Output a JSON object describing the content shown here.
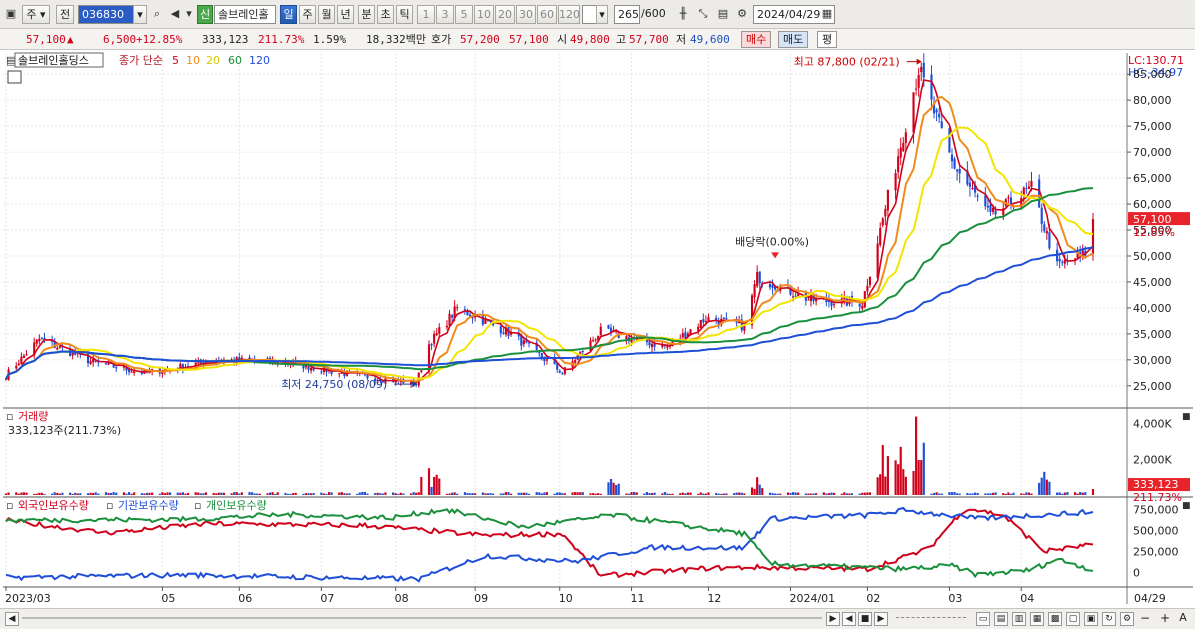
{
  "toolbar": {
    "period_main": "주",
    "prefix": "전",
    "stock_code": "036830",
    "new_badge": "신",
    "stock_name": "솔브레인홀",
    "periods": [
      "일",
      "주",
      "월",
      "년",
      "분",
      "초",
      "틱"
    ],
    "active_period": "일",
    "intervals": [
      "1",
      "3",
      "5",
      "10",
      "20",
      "30",
      "60",
      "120"
    ],
    "count_value": "265",
    "count_total": "/600",
    "date": "2024/04/29"
  },
  "quote": {
    "price": "57,100",
    "arrow": "▲",
    "change": "6,500",
    "change_pct": "+12.85%",
    "volume": "333,123",
    "volume_ratio": "211.73%",
    "turnover": "1.59%",
    "amount": "18,332백만",
    "ask_label": "호가",
    "ask1": "57,200",
    "ask2": "57,100",
    "open_label": "시",
    "open": "49,800",
    "high_label": "고",
    "high": "57,700",
    "low_label": "저",
    "low": "49,600",
    "buy": "매수",
    "sell": "매도",
    "flat": "평"
  },
  "chart_data": [
    {
      "type": "candlestick",
      "title": "솔브레인홀딩스",
      "indicator_label": "종가 단순",
      "ma_periods": [
        "5",
        "10",
        "20",
        "60",
        "120"
      ],
      "ma_colors": [
        "#d0021b",
        "#f08c1c",
        "#f2e600",
        "#1a8f3c",
        "#1f4fd8"
      ],
      "up_color": "#d0021b",
      "down_color": "#1f4fd8",
      "y_ticks": [
        85000,
        80000,
        75000,
        70000,
        65000,
        60000,
        55000,
        50000,
        45000,
        40000,
        35000,
        30000,
        25000
      ],
      "y_tick_labels": [
        "85,000",
        "80,000",
        "75,000",
        "70,000",
        "65,000",
        "60,000",
        "55,000",
        "50,000",
        "45,000",
        "40,000",
        "35,000",
        "30,000",
        "25,000"
      ],
      "ylim": [
        21500,
        88500
      ],
      "lc_label": "LC:130.71",
      "hc_label": "HC:-34.97",
      "last_price_label": "57,100",
      "last_pct_label": "12.85%",
      "annotations": [
        {
          "text": "최고 87,800 (02/21)",
          "date": "2024-02-21",
          "value": 87800
        },
        {
          "text": "최저 24,750 (08/09)",
          "date": "2023-08-09",
          "value": 24750
        },
        {
          "text": "배당락(0.00%)",
          "date": "2023-12-27",
          "value": 48000
        }
      ],
      "close_key_points": [
        [
          "2023-03-02",
          27000
        ],
        [
          "2023-03-15",
          34000
        ],
        [
          "2023-04-05",
          29500
        ],
        [
          "2023-04-25",
          27500
        ],
        [
          "2023-05-25",
          30000
        ],
        [
          "2023-06-20",
          29500
        ],
        [
          "2023-07-10",
          27500
        ],
        [
          "2023-08-09",
          25500
        ],
        [
          "2023-08-14",
          33000
        ],
        [
          "2023-08-25",
          40000
        ],
        [
          "2023-09-15",
          35000
        ],
        [
          "2023-10-05",
          27500
        ],
        [
          "2023-10-20",
          35500
        ],
        [
          "2023-11-15",
          32500
        ],
        [
          "2023-11-30",
          38000
        ],
        [
          "2023-12-15",
          36500
        ],
        [
          "2023-12-20",
          46000
        ],
        [
          "2024-01-10",
          41500
        ],
        [
          "2024-01-30",
          41000
        ],
        [
          "2024-02-06",
          55000
        ],
        [
          "2024-02-21",
          86000
        ],
        [
          "2024-03-05",
          68000
        ],
        [
          "2024-03-20",
          57500
        ],
        [
          "2024-04-05",
          63000
        ],
        [
          "2024-04-15",
          48000
        ],
        [
          "2024-04-26",
          50600
        ],
        [
          "2024-04-29",
          57100
        ]
      ]
    },
    {
      "type": "bar",
      "title": "거래량",
      "summary": "333,123주(211.73%)",
      "y_tick_labels": [
        "4,000K",
        "2,000K"
      ],
      "ylim": [
        0,
        4600000
      ],
      "last_value_label": "333,123",
      "last_pct_label": "211.73%",
      "spikes": [
        {
          "date": "2023-08-14",
          "value": 1500000
        },
        {
          "date": "2023-08-16",
          "value": 2000000
        },
        {
          "date": "2023-10-24",
          "value": 900000
        },
        {
          "date": "2023-12-20",
          "value": 1000000
        },
        {
          "date": "2024-02-07",
          "value": 2800000
        },
        {
          "date": "2024-02-14",
          "value": 2700000
        },
        {
          "date": "2024-02-16",
          "value": 3000000
        },
        {
          "date": "2024-02-20",
          "value": 4400000
        },
        {
          "date": "2024-04-10",
          "value": 1300000
        }
      ]
    },
    {
      "type": "line",
      "series_names": [
        "외국인보유수량",
        "기관보유수량",
        "개인보유수량"
      ],
      "series_colors": [
        "#d0021b",
        "#1f4fd8",
        "#1a8f3c"
      ],
      "y_tick_labels": [
        "750,000",
        "500,000",
        "250,000",
        "0"
      ],
      "ylim": [
        -150000,
        850000
      ],
      "x_tick_labels": [
        "2023/03",
        "05",
        "06",
        "07",
        "08",
        "09",
        "10",
        "11",
        "12",
        "2024/01",
        "02",
        "03",
        "04"
      ],
      "last_date_label": "04/29",
      "key_points": {
        "외국인보유수량": [
          [
            "2023-03-02",
            620000
          ],
          [
            "2023-04-10",
            470000
          ],
          [
            "2023-05-20",
            580000
          ],
          [
            "2023-07-20",
            560000
          ],
          [
            "2023-09-05",
            440000
          ],
          [
            "2023-10-05",
            460000
          ],
          [
            "2023-10-20",
            -40000
          ],
          [
            "2023-12-01",
            50000
          ],
          [
            "2023-12-20",
            60000
          ],
          [
            "2024-02-01",
            40000
          ],
          [
            "2024-02-25",
            280000
          ],
          [
            "2024-03-10",
            770000
          ],
          [
            "2024-03-25",
            680000
          ],
          [
            "2024-04-10",
            250000
          ],
          [
            "2024-04-29",
            330000
          ]
        ],
        "기관보유수량": [
          [
            "2023-03-02",
            -60000
          ],
          [
            "2023-05-10",
            -30000
          ],
          [
            "2023-08-10",
            -80000
          ],
          [
            "2023-09-05",
            200000
          ],
          [
            "2023-10-10",
            130000
          ],
          [
            "2023-11-10",
            300000
          ],
          [
            "2023-12-15",
            290000
          ],
          [
            "2023-12-25",
            640000
          ],
          [
            "2024-02-01",
            680000
          ],
          [
            "2024-02-15",
            740000
          ],
          [
            "2024-03-15",
            640000
          ],
          [
            "2024-04-29",
            720000
          ]
        ],
        "개인보유수량": [
          [
            "2023-03-02",
            620000
          ],
          [
            "2023-05-10",
            630000
          ],
          [
            "2023-06-20",
            690000
          ],
          [
            "2023-07-30",
            650000
          ],
          [
            "2023-08-20",
            750000
          ],
          [
            "2023-09-20",
            540000
          ],
          [
            "2023-10-25",
            680000
          ],
          [
            "2023-12-15",
            460000
          ],
          [
            "2023-12-25",
            100000
          ],
          [
            "2024-02-15",
            40000
          ],
          [
            "2024-03-05",
            80000
          ],
          [
            "2024-03-15",
            -30000
          ],
          [
            "2024-04-05",
            30000
          ],
          [
            "2024-04-15",
            160000
          ],
          [
            "2024-04-29",
            30000
          ]
        ]
      }
    }
  ]
}
